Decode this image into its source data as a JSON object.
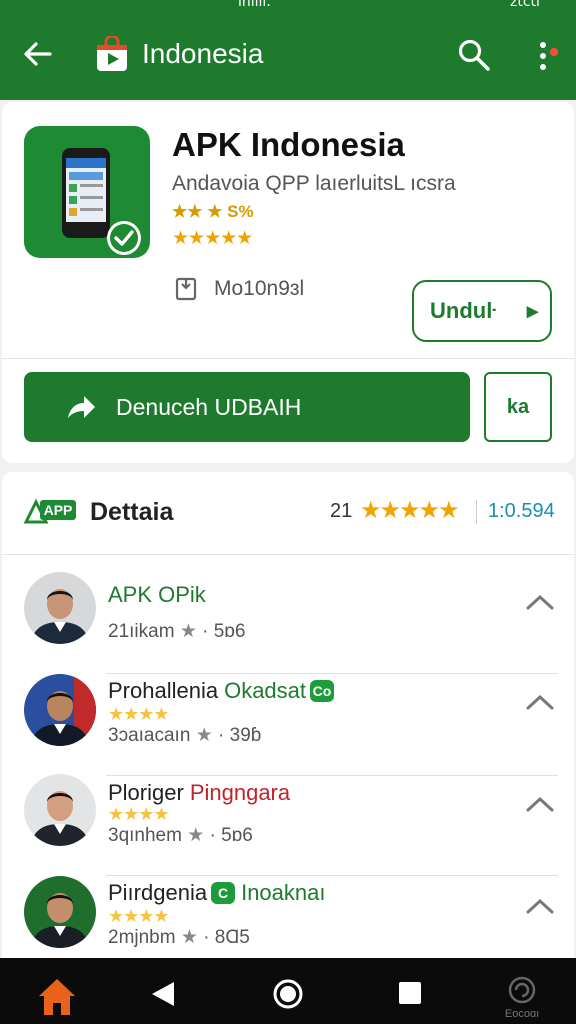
{
  "status_bar": {
    "left": "ınıııı.",
    "right": "ztcti"
  },
  "app_bar": {
    "title": "Indonesia"
  },
  "app": {
    "name": "APK Indonesia",
    "subtitle": "Andavoia QPP laıerluitsL ıcsra",
    "rating_small": "★★ ★ S%",
    "stars": "★★★★★",
    "size": "Mo10n9ɜl",
    "unduh_label": "Unduŀ",
    "unduh_chevron": "▸",
    "download_label": "Denuceh UDBAIH",
    "square_label": "ka"
  },
  "details": {
    "logo_text": "APP",
    "title": "Dettaia",
    "count": "21",
    "stars": "★★★★★",
    "value": "1:0.594"
  },
  "list": [
    {
      "name": "APK OPik",
      "accent": "",
      "badge": "",
      "stars": "",
      "meta_left": "21ıikam",
      "meta_right": "· 5ɒ6"
    },
    {
      "name": "Prohallenia",
      "accent": "Okadsat",
      "badge": "Co",
      "stars": "★★★★",
      "meta_left": "3ɔaıacaın",
      "meta_right": "· 39ɓ"
    },
    {
      "name": "Ploriger",
      "accent": "Pingngara",
      "badge": "",
      "stars": "★★★★",
      "meta_left": "3qınhem",
      "meta_right": "· 5ɒ6"
    },
    {
      "name": "Piırdgenia",
      "accent": "Inoaknaı",
      "badge": "C",
      "stars": "★★★★",
      "meta_left": "2mjnbm",
      "meta_right": "· 8Ɑ5"
    }
  ],
  "nav": {
    "other_label": "Eocoɑı"
  },
  "colors": {
    "primary": "#1e7b2e",
    "star": "#f0a500",
    "accent_red": "#c0242a",
    "home": "#e8621c"
  }
}
